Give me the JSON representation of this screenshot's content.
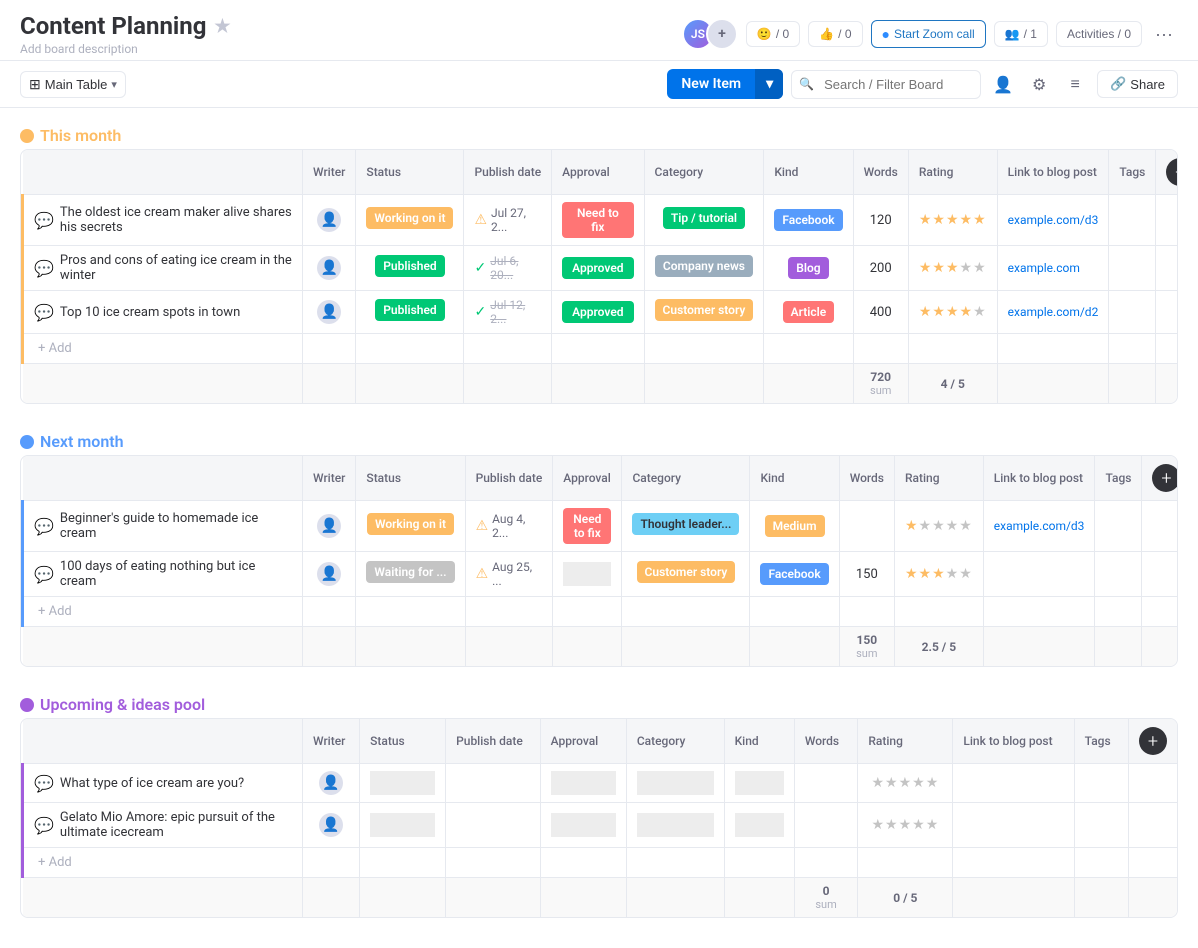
{
  "header": {
    "title": "Content Planning",
    "star_label": "★",
    "description": "Add board description",
    "reactions_count": "/ 0",
    "likes_count": "/ 0",
    "zoom_label": "Start Zoom call",
    "guests_label": "/ 1",
    "activities_label": "Activities / 0",
    "share_label": "Share"
  },
  "toolbar": {
    "table_label": "Main Table",
    "new_item_label": "New Item",
    "search_placeholder": "Search / Filter Board",
    "chevron": "▾"
  },
  "groups": [
    {
      "id": "this-month",
      "title": "This month",
      "color_class": "group-this-month",
      "columns": [
        "Writer",
        "Status",
        "Publish date",
        "Approval",
        "Category",
        "Kind",
        "Words",
        "Rating",
        "Link to blog post",
        "Tags"
      ],
      "rows": [
        {
          "name": "The oldest ice cream maker alive shares his secrets",
          "status": "Working on it",
          "status_class": "status-working",
          "publish_date": "Jul 27, 2...",
          "publish_icon": "warning",
          "approval": "Need to fix",
          "approval_class": "approval-fix",
          "category": "Tip / tutorial",
          "category_class": "cat-tutorial",
          "kind": "Facebook",
          "kind_class": "kind-facebook",
          "words": "120",
          "rating": 5,
          "link": "example.com/d3"
        },
        {
          "name": "Pros and cons of eating ice cream in the winter",
          "status": "Published",
          "status_class": "status-published",
          "publish_date": "Jul 6, 20...",
          "publish_icon": "check",
          "publish_strikethrough": true,
          "approval": "Approved",
          "approval_class": "approval-approved",
          "category": "Company news",
          "category_class": "cat-company",
          "kind": "Blog",
          "kind_class": "kind-blog",
          "words": "200",
          "rating": 3,
          "link": "example.com"
        },
        {
          "name": "Top 10 ice cream spots in town",
          "status": "Published",
          "status_class": "status-published",
          "publish_date": "Jul 12, 2...",
          "publish_icon": "check",
          "publish_strikethrough": true,
          "approval": "Approved",
          "approval_class": "approval-approved",
          "category": "Customer story",
          "category_class": "cat-customer",
          "kind": "Article",
          "kind_class": "kind-article",
          "words": "400",
          "rating": 4,
          "link": "example.com/d2"
        }
      ],
      "summary": {
        "words_sum": "720",
        "rating_avg": "4 / 5"
      }
    },
    {
      "id": "next-month",
      "title": "Next month",
      "color_class": "group-next-month",
      "columns": [
        "Writer",
        "Status",
        "Publish date",
        "Approval",
        "Category",
        "Kind",
        "Words",
        "Rating",
        "Link to blog post",
        "Tags"
      ],
      "rows": [
        {
          "name": "Beginner's guide to homemade ice cream",
          "status": "Working on it",
          "status_class": "status-working",
          "publish_date": "Aug 4, 2...",
          "publish_icon": "warning",
          "approval": "Need to fix",
          "approval_class": "approval-fix",
          "category": "Thought leader...",
          "category_class": "cat-thought",
          "kind": "Medium",
          "kind_class": "kind-medium",
          "words": "",
          "rating": 1,
          "link": "example.com/d3"
        },
        {
          "name": "100 days of eating nothing but ice cream",
          "status": "Waiting for ...",
          "status_class": "status-waiting",
          "publish_date": "Aug 25, ...",
          "publish_icon": "warning",
          "approval": "",
          "approval_class": "approval-empty",
          "category": "Customer story",
          "category_class": "cat-customer",
          "kind": "Facebook",
          "kind_class": "kind-facebook",
          "words": "150",
          "rating": 3,
          "link": ""
        }
      ],
      "summary": {
        "words_sum": "150",
        "rating_avg": "2.5 / 5"
      }
    },
    {
      "id": "upcoming",
      "title": "Upcoming & ideas pool",
      "color_class": "group-upcoming",
      "columns": [
        "Writer",
        "Status",
        "Publish date",
        "Approval",
        "Category",
        "Kind",
        "Words",
        "Rating",
        "Link to blog post",
        "Tags"
      ],
      "rows": [
        {
          "name": "What type of ice cream are you?",
          "status": "",
          "status_class": "status-empty",
          "publish_date": "",
          "publish_icon": "",
          "approval": "",
          "approval_class": "approval-empty",
          "category": "",
          "category_class": "cat-empty",
          "kind": "",
          "kind_class": "kind-empty",
          "words": "",
          "rating": 0,
          "link": ""
        },
        {
          "name": "Gelato Mio Amore: epic pursuit of the ultimate icecream",
          "status": "",
          "status_class": "status-empty",
          "publish_date": "",
          "publish_icon": "",
          "approval": "",
          "approval_class": "approval-empty",
          "category": "",
          "category_class": "cat-empty",
          "kind": "",
          "kind_class": "kind-empty",
          "words": "",
          "rating": 0,
          "link": ""
        }
      ],
      "summary": {
        "words_sum": "0",
        "rating_avg": "0 / 5"
      }
    }
  ],
  "labels": {
    "add": "+ Add",
    "sum": "sum",
    "writer_col": "Writer",
    "status_col": "Status",
    "publish_col": "Publish date",
    "approval_col": "Approval",
    "category_col": "Category",
    "kind_col": "Kind",
    "words_col": "Words",
    "rating_col": "Rating",
    "link_col": "Link to blog post",
    "tags_col": "Tags"
  }
}
